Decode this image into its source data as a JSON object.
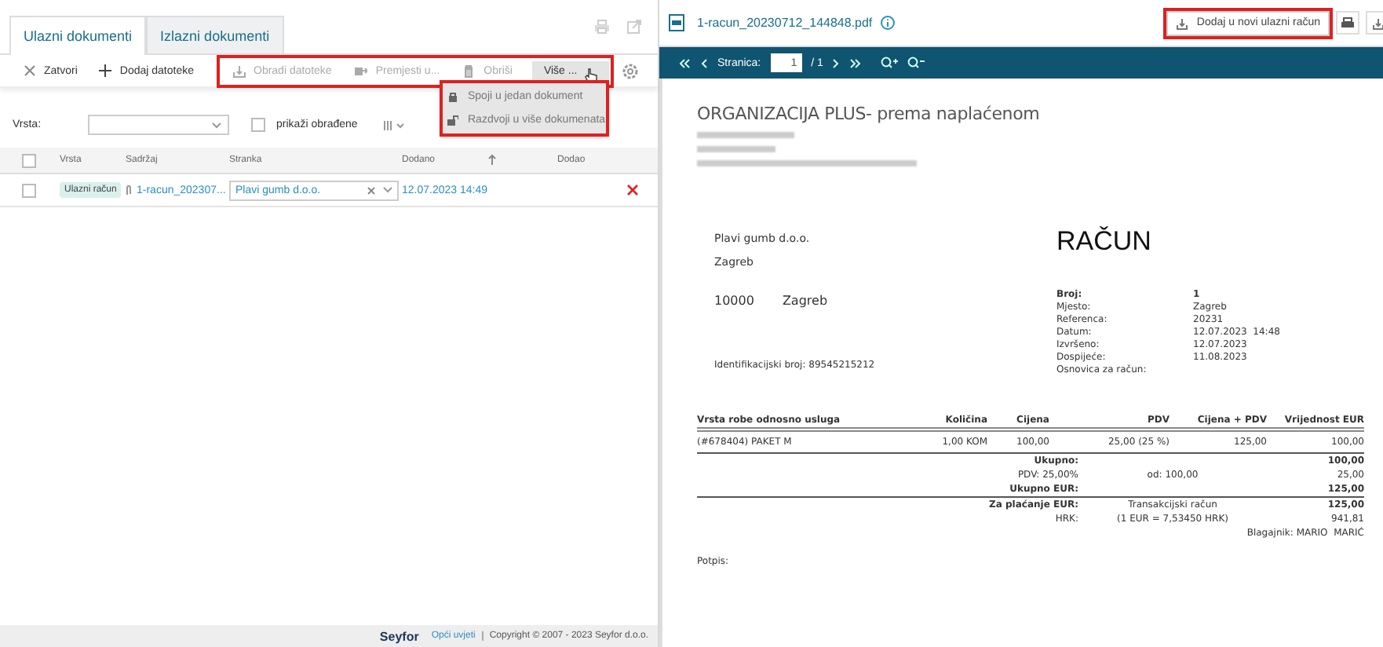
{
  "left": {
    "tabs": [
      {
        "label": "Ulazni dokumenti",
        "selected": true
      },
      {
        "label": "Izlazni dokumenti",
        "selected": false
      }
    ],
    "toolbar": {
      "actions": [
        {
          "label": "Zatvori"
        },
        {
          "label": "Dodaj datoteke"
        }
      ],
      "group_highlighted": true,
      "group_actions": [
        {
          "label": "Obradi datoteke",
          "disabled": true,
          "expanded": false
        },
        {
          "label": "Premjesti u...",
          "disabled": true,
          "expanded": false
        },
        {
          "label": "Obriši",
          "disabled": true,
          "expanded": false
        },
        {
          "label": "Više ...",
          "disabled": false,
          "expanded": true
        }
      ],
      "menu_highlighted": true,
      "menu": [
        {
          "label": "Spoji u jedan dokument"
        },
        {
          "label": "Razdvoji u više dokumenata"
        }
      ]
    },
    "filter": {
      "label": "Vrsta:",
      "show_processed": {
        "label": "prikaži obrađene",
        "checked": false
      }
    },
    "table": {
      "all_selected": false,
      "columns": [
        "Vrsta",
        "Sadržaj",
        "Stranka",
        "Dodano",
        "Dodao"
      ],
      "rows": [
        {
          "selected": false,
          "type": "Ulazni račun",
          "content": "1-racun_202307...",
          "party": "Plavi gumb d.o.o.",
          "added": "12.07.2023 14:49"
        }
      ]
    },
    "footer": {
      "brand": "Seyfor",
      "terms_link": "Opći uvjeti",
      "copyright": "Copyright © 2007 - 2023 Seyfor d.o.o."
    }
  },
  "right": {
    "file_name": "1-racun_20230712_144848.pdf",
    "add_button": {
      "label": "Dodaj u novi ulazni račun",
      "highlighted": true
    },
    "pager": {
      "label": "Stranica:",
      "page": "1",
      "total": "/ 1"
    },
    "document": {
      "company": "ORGANIZACIJA PLUS- prema naplaćenom",
      "address_blurred": true,
      "customer": [
        "Plavi gumb d.o.o.",
        "Zagreb"
      ],
      "postal": {
        "code": "10000",
        "city": "Zagreb"
      },
      "title": "RAČUN",
      "meta": [
        {
          "label": "Broj:",
          "value": "1",
          "bold": true
        },
        {
          "label": "Mjesto:",
          "value": "Zagreb",
          "bold": false
        },
        {
          "label": "Referenca:",
          "value": "20231",
          "bold": false
        },
        {
          "label": "Datum:",
          "value": "12.07.2023  14:48",
          "bold": false
        },
        {
          "label": "Izvršeno:",
          "value": "12.07.2023",
          "bold": false
        },
        {
          "label": "Dospijeće:",
          "value": "11.08.2023",
          "bold": false
        },
        {
          "label": "Osnovica za račun:",
          "bold": false
        }
      ],
      "id_line": "Identifikacijski broj: 89545215212",
      "items": {
        "columns": [
          "Vrsta robe odnosno usluga",
          "Količina",
          "Cijena",
          "PDV",
          "Cijena + PDV",
          "Vrijednost EUR"
        ],
        "rows": [
          [
            "(#678404) PAKET M",
            "1,00 KOM",
            "100,00",
            "25,00 (25 %)",
            "125,00",
            "100,00"
          ]
        ]
      },
      "totals": [
        {
          "label": "Ukupno:",
          "value": "100,00",
          "bold": true,
          "rule_after": false
        },
        {
          "label": "PDV: 25,00%",
          "middle": "od: 100,00",
          "value": "25,00",
          "bold": false,
          "rule_after": false
        },
        {
          "label": "Ukupno EUR:",
          "value": "125,00",
          "bold": true,
          "rule_after": true
        },
        {
          "label": "Za plaćanje EUR:",
          "middle": "Transakcijski račun",
          "value": "125,00",
          "bold": true,
          "rule_after": false
        },
        {
          "label": "HRK:",
          "middle": "(1 EUR = 7,53450 HRK)",
          "value": "941,81",
          "bold": false,
          "rule_after": false
        }
      ],
      "cashier": "Blagajnik: MARIO  MARIĆ",
      "signature": "Potpis:"
    }
  }
}
